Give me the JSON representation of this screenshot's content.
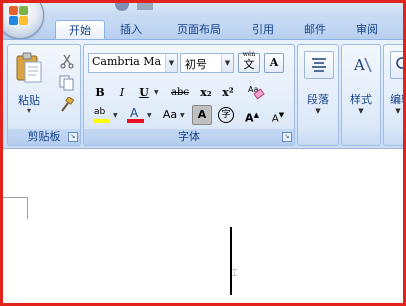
{
  "tabs": [
    "开始",
    "插入",
    "页面布局",
    "引用",
    "邮件",
    "审阅"
  ],
  "active_tab": "开始",
  "clipboard": {
    "group_label": "剪贴板",
    "paste_label": "粘贴",
    "paste_arrow": "▾",
    "cut_icon": "scissors-icon",
    "copy_icon": "copy-icon",
    "format_painter_icon": "paintbrush-icon"
  },
  "font": {
    "group_label": "字体",
    "font_name": "Cambria Ma",
    "font_size": "初号",
    "phonetic_guide_top": "wén",
    "phonetic_guide_char": "文",
    "char_border_label": "A",
    "bold_label": "B",
    "italic_label": "I",
    "underline_label": "U",
    "strikethrough_label": "abc",
    "subscript_label": "x₂",
    "superscript_label": "x²",
    "clear_formatting_icon": "eraser-icon",
    "highlight_label": "ab",
    "font_color_label": "A",
    "change_case_label": "Aa",
    "char_shading_label": "A",
    "enclose_char_label": "字",
    "grow_font_label": "A",
    "shrink_font_label": "A",
    "highlight_color": "#ffff00",
    "font_color": "#e81123"
  },
  "paragraph": {
    "group_label": "段落",
    "icon": "align-center-icon"
  },
  "styles": {
    "group_label": "样式",
    "icon": "styles-icon"
  },
  "editing": {
    "group_label": "编辑"
  },
  "accent_colors": {
    "border_highlight": "#e0241d",
    "ribbon_text": "#15428b"
  }
}
